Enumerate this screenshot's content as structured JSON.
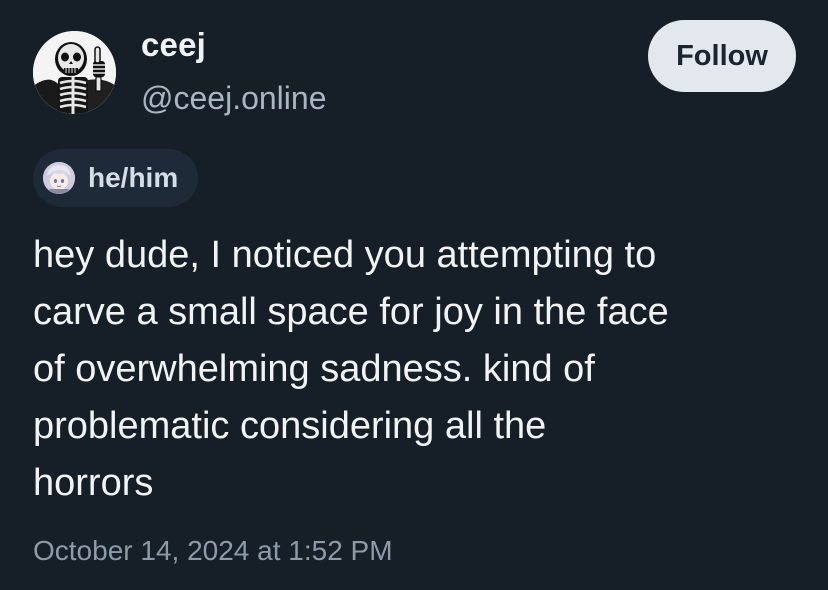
{
  "author": {
    "display_name": "ceej",
    "handle": "@ceej.online",
    "avatar_icon": "skeleton-thumbs-up-avatar"
  },
  "actions": {
    "follow_label": "Follow"
  },
  "pronouns": {
    "label": "he/him",
    "badge_icon": "anime-character-badge-icon"
  },
  "post": {
    "lines": [
      "hey dude, I noticed you attempting to",
      "carve a small space for joy in the face",
      "of overwhelming sadness. kind of",
      "problematic considering all the",
      "horrors"
    ],
    "timestamp": "October 14, 2024 at 1:52 PM"
  },
  "colors": {
    "background": "#161e27",
    "follow_button_bg": "#e3e8ee",
    "pill_bg": "#1e2a38",
    "text_primary": "#f1f3f5",
    "text_secondary": "#aab5c2"
  }
}
